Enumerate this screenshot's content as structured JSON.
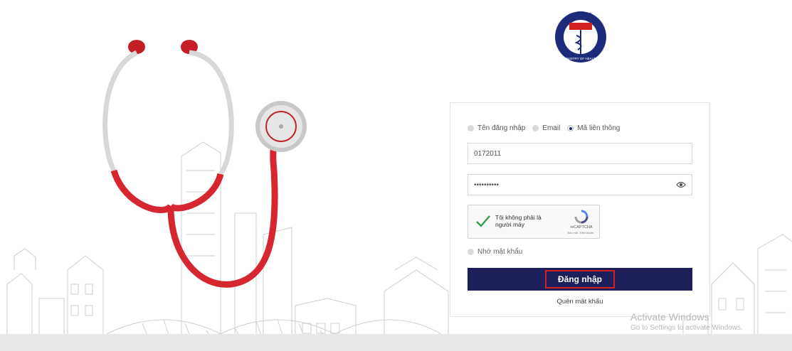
{
  "logo": {
    "top_text": "BỘ Y TẾ",
    "bottom_text": "MINISTRY OF HEALTH"
  },
  "login": {
    "login_types": [
      {
        "label": "Tên đăng nhập",
        "selected": false
      },
      {
        "label": "Email",
        "selected": false
      },
      {
        "label": "Mã liên thông",
        "selected": true
      }
    ],
    "username_value": "0172011",
    "password_value": "••••••••••",
    "password_toggle_icon": "eye-icon",
    "remember_label": "Nhớ mật khẩu",
    "submit_label": "Đăng nhập",
    "forgot_label": "Quên mật khẩu"
  },
  "captcha": {
    "label": "Tôi không phải là người máy",
    "brand": "reCAPTCHA",
    "terms": "Bảo mật - Điều khoản"
  },
  "watermark": {
    "line1": "Activate Windows",
    "line2": "Go to Settings to activate Windows."
  },
  "colors": {
    "primary_button": "#1d1f5a",
    "highlight": "#d32020",
    "stethoscope": "#d6262f"
  }
}
